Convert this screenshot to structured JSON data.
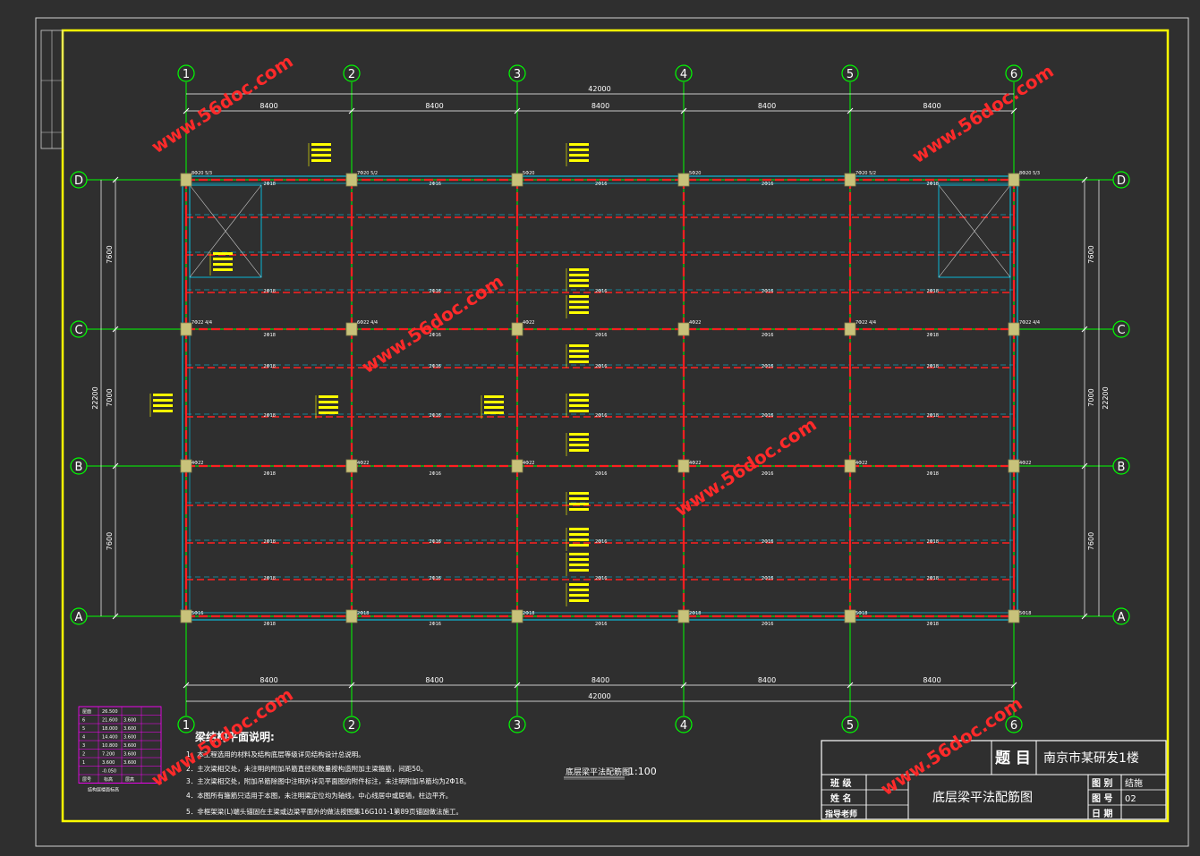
{
  "axes": {
    "columns": [
      "1",
      "2",
      "3",
      "4",
      "5",
      "6"
    ],
    "rows": [
      "D",
      "C",
      "B",
      "A"
    ]
  },
  "dimensions": {
    "total_width": "42000",
    "bay_widths": [
      "8400",
      "8400",
      "8400",
      "8400",
      "8400"
    ],
    "row_spacings": [
      "7600",
      "7000",
      "7600"
    ],
    "total_depth": "22200"
  },
  "watermark": "www.56doc.com",
  "drawing_caption": {
    "name": "底层梁平法配筋图",
    "scale": "1:100"
  },
  "notes": {
    "title": "梁结构平面说明:",
    "items": [
      "1．本工程选用的材料及结构底层等级详见结构设计总说明。",
      "2．主次梁相交处，未注明的附加吊筋直径和数量按构造附加主梁箍筋，间距50。",
      "3．主次梁相交处，附加吊筋除图中注明外详见平面图的附件标注，未注明附加吊筋均为2Φ18。",
      "4．本图所有箍筋只适用于本图，未注明梁定位均为轴线，中心线居中或居墙，柱边平齐。",
      "5．非框架梁(L)端头锚固在主梁或边梁平面外的做法按图集16G101-1第89页锚固做法施工。"
    ]
  },
  "floor_table": {
    "headers": [
      "层号",
      "标高",
      "层高"
    ],
    "rows": [
      [
        "屋面",
        "26.500",
        ""
      ],
      [
        "6",
        "21.600",
        "3.600"
      ],
      [
        "5",
        "18.000",
        "3.600"
      ],
      [
        "4",
        "14.400",
        "3.600"
      ],
      [
        "3",
        "10.800",
        "3.600"
      ],
      [
        "2",
        "7.200",
        "3.600"
      ],
      [
        "1",
        "3.600",
        "3.600"
      ],
      [
        "",
        "-0.050",
        ""
      ]
    ],
    "caption": "结构层楼面标高"
  },
  "title_block": {
    "topic_label": "题 目",
    "project": "南京市某研发1楼",
    "row_labels": [
      "班 级",
      "姓 名",
      "指导老师"
    ],
    "drawing_title": "底层梁平法配筋图",
    "right_labels": [
      "图 别",
      "图 号",
      "日 期"
    ],
    "right_values": [
      "结施",
      "02",
      ""
    ]
  },
  "beam_labels": {
    "grid_top": [
      "8Φ20 5/3",
      "7Φ20 5/2",
      "5Φ20",
      "5Φ20",
      "7Φ20 5/2",
      "8Φ20 5/3"
    ],
    "grid_c": [
      "7Φ22 4/4",
      "6Φ22 4/4",
      "4Φ22",
      "4Φ22",
      "7Φ22 4/4",
      "7Φ22 4/4"
    ],
    "grid_b": [
      "4Φ22",
      "4Φ22",
      "4Φ22",
      "4Φ22",
      "4Φ22",
      "4Φ22"
    ],
    "grid_a": [
      "5Φ16",
      "2Φ18",
      "2Φ18",
      "2Φ18",
      "5Φ18",
      "5Φ18"
    ],
    "span_mid": [
      "2Φ18",
      "2Φ16",
      "2Φ16",
      "2Φ16",
      "2Φ18"
    ]
  },
  "colors": {
    "background": "#2f2f2f",
    "frame": "#ffff00",
    "axis": "#00ff00",
    "beam": "#ff2020",
    "column": "#c8c27a",
    "outline": "#00d8ff",
    "text": "#ffffff",
    "watermark": "#ff2a2a"
  }
}
